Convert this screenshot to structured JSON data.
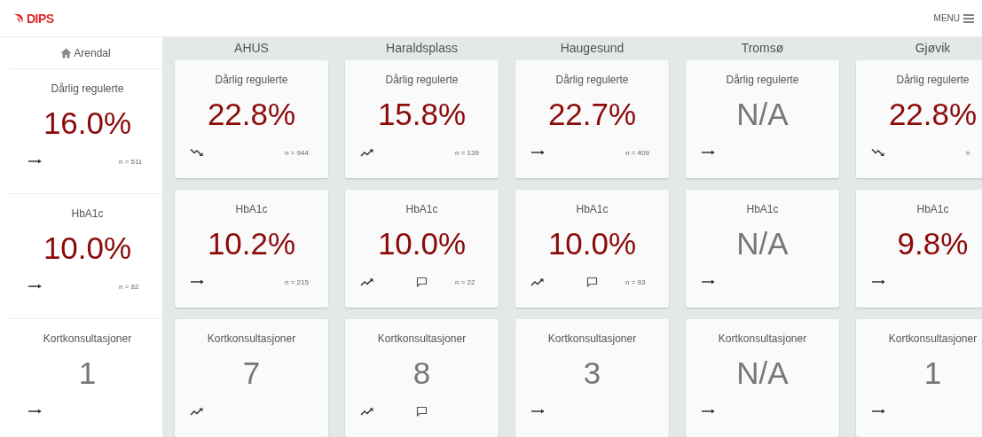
{
  "header": {
    "logo": "DIPS",
    "menu": "MENU"
  },
  "home": {
    "name": "Arendal",
    "metrics": [
      {
        "title": "Dårlig regulerte",
        "value": "16.0%",
        "highlighted": true,
        "trend": {
          "kind": "flat"
        },
        "comment": false,
        "count": "n = 511"
      },
      {
        "title": "HbA1c",
        "value": "10.0%",
        "highlighted": true,
        "trend": {
          "kind": "flat"
        },
        "comment": false,
        "count": "n = 82"
      },
      {
        "title": "Kortkonsultasjoner",
        "value": "1",
        "highlighted": false,
        "trend": {
          "kind": "flat"
        },
        "comment": false
      }
    ]
  },
  "columns": [
    {
      "name": "AHUS",
      "metrics": [
        {
          "title": "Dårlig regulerte",
          "value": "22.8%",
          "highlighted": true,
          "trend": {
            "kind": "down"
          },
          "comment": false,
          "count": "n = 944"
        },
        {
          "title": "HbA1c",
          "value": "10.2%",
          "highlighted": true,
          "trend": {
            "kind": "flat"
          },
          "comment": false,
          "count": "n = 215"
        },
        {
          "title": "Kortkonsultasjoner",
          "value": "7",
          "highlighted": false,
          "trend": {
            "kind": "up"
          },
          "comment": false
        }
      ]
    },
    {
      "name": "Haraldsplass",
      "metrics": [
        {
          "title": "Dårlig regulerte",
          "value": "15.8%",
          "highlighted": true,
          "trend": {
            "kind": "up"
          },
          "comment": false,
          "count": "n = 139"
        },
        {
          "title": "HbA1c",
          "value": "10.0%",
          "highlighted": true,
          "trend": {
            "kind": "up"
          },
          "comment": true,
          "count": "n = 22"
        },
        {
          "title": "Kortkonsultasjoner",
          "value": "8",
          "highlighted": false,
          "trend": {
            "kind": "up"
          },
          "comment": true
        }
      ]
    },
    {
      "name": "Haugesund",
      "metrics": [
        {
          "title": "Dårlig regulerte",
          "value": "22.7%",
          "highlighted": true,
          "trend": {
            "kind": "flat"
          },
          "comment": false,
          "count": "n = 409"
        },
        {
          "title": "HbA1c",
          "value": "10.0%",
          "highlighted": true,
          "trend": {
            "kind": "up"
          },
          "comment": true,
          "count": "n = 93"
        },
        {
          "title": "Kortkonsultasjoner",
          "value": "3",
          "highlighted": false,
          "trend": {
            "kind": "flat"
          },
          "comment": false
        }
      ]
    },
    {
      "name": "Tromsø",
      "metrics": [
        {
          "title": "Dårlig regulerte",
          "value": "N/A",
          "highlighted": false,
          "trend": {
            "kind": "flat"
          },
          "comment": false
        },
        {
          "title": "HbA1c",
          "value": "N/A",
          "highlighted": false,
          "trend": {
            "kind": "flat"
          },
          "comment": false
        },
        {
          "title": "Kortkonsultasjoner",
          "value": "N/A",
          "highlighted": false,
          "trend": {
            "kind": "flat"
          },
          "comment": false
        }
      ]
    },
    {
      "name": "Gjøvik",
      "metrics": [
        {
          "title": "Dårlig regulerte",
          "value": "22.8%",
          "highlighted": true,
          "trend": {
            "kind": "down"
          },
          "comment": false,
          "count": "n"
        },
        {
          "title": "HbA1c",
          "value": "9.8%",
          "highlighted": true,
          "trend": {
            "kind": "flat"
          },
          "comment": false
        },
        {
          "title": "Kortkonsultasjoner",
          "value": "1",
          "highlighted": false,
          "trend": {
            "kind": "flat"
          },
          "comment": false
        }
      ]
    }
  ]
}
